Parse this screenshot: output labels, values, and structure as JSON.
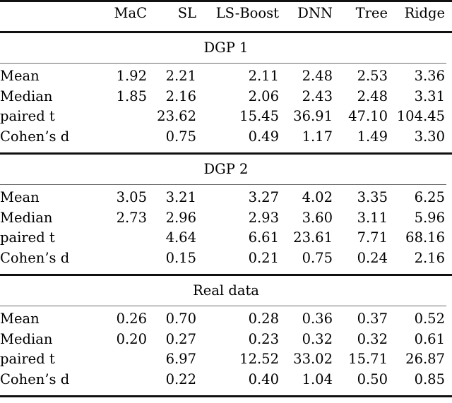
{
  "table": {
    "columns": [
      {
        "key": "label",
        "label": ""
      },
      {
        "key": "mac",
        "label": "MaC"
      },
      {
        "key": "sl",
        "label": "SL"
      },
      {
        "key": "lsboost",
        "label": "LS-Boost"
      },
      {
        "key": "dnn",
        "label": "DNN"
      },
      {
        "key": "tree",
        "label": "Tree"
      },
      {
        "key": "ridge",
        "label": "Ridge"
      }
    ],
    "sections": [
      {
        "title": "DGP 1",
        "rows": [
          {
            "label": "Mean",
            "values": [
              "1.92",
              "2.21",
              "2.11",
              "2.48",
              "2.53",
              "3.36"
            ]
          },
          {
            "label": "Median",
            "values": [
              "1.85",
              "2.16",
              "2.06",
              "2.43",
              "2.48",
              "3.31"
            ]
          },
          {
            "label": "paired t",
            "values": [
              "",
              "23.62",
              "15.45",
              "36.91",
              "47.10",
              "104.45"
            ]
          },
          {
            "label": "Cohen’s d",
            "values": [
              "",
              "0.75",
              "0.49",
              "1.17",
              "1.49",
              "3.30"
            ]
          }
        ]
      },
      {
        "title": "DGP 2",
        "rows": [
          {
            "label": "Mean",
            "values": [
              "3.05",
              "3.21",
              "3.27",
              "4.02",
              "3.35",
              "6.25"
            ]
          },
          {
            "label": "Median",
            "values": [
              "2.73",
              "2.96",
              "2.93",
              "3.60",
              "3.11",
              "5.96"
            ]
          },
          {
            "label": "paired t",
            "values": [
              "",
              "4.64",
              "6.61",
              "23.61",
              "7.71",
              "68.16"
            ]
          },
          {
            "label": "Cohen’s d",
            "values": [
              "",
              "0.15",
              "0.21",
              "0.75",
              "0.24",
              "2.16"
            ]
          }
        ]
      },
      {
        "title": "Real data",
        "rows": [
          {
            "label": "Mean",
            "values": [
              "0.26",
              "0.70",
              "0.28",
              "0.36",
              "0.37",
              "0.52"
            ]
          },
          {
            "label": "Median",
            "values": [
              "0.20",
              "0.27",
              "0.23",
              "0.32",
              "0.32",
              "0.61"
            ]
          },
          {
            "label": "paired t",
            "values": [
              "",
              "6.97",
              "12.52",
              "33.02",
              "15.71",
              "26.87"
            ]
          },
          {
            "label": "Cohen’s d",
            "values": [
              "",
              "0.22",
              "0.40",
              "1.04",
              "0.50",
              "0.85"
            ]
          }
        ]
      }
    ]
  }
}
